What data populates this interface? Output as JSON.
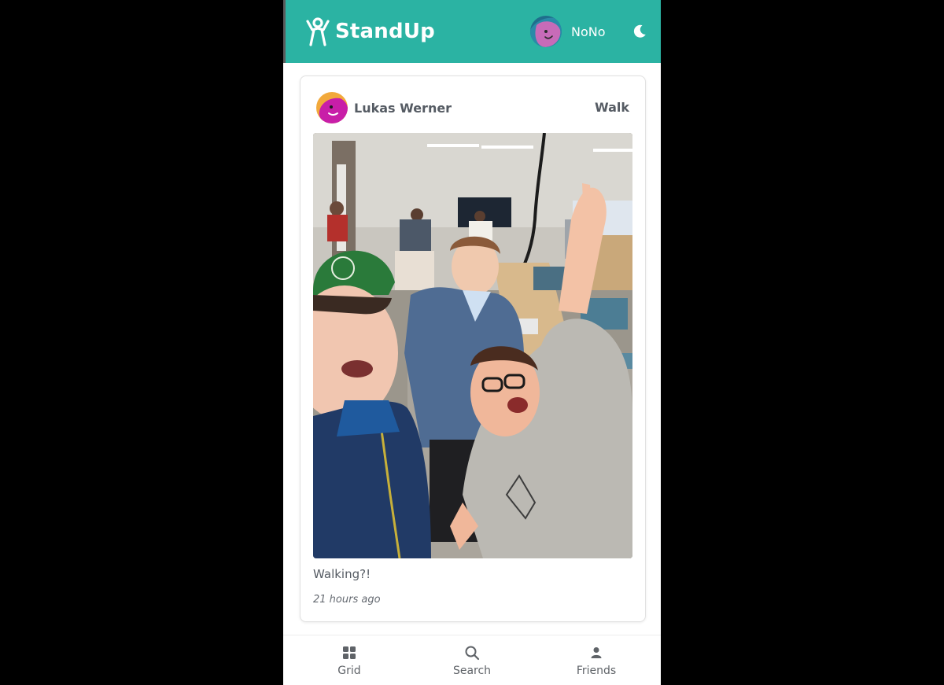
{
  "app": {
    "brand_name": "StandUp",
    "colors": {
      "header": "#2bb3a3",
      "text_muted": "#555b63"
    }
  },
  "header": {
    "user_name": "NoNo",
    "brand_icon": "person-waving-icon",
    "avatar_icon": "blob-face-avatar",
    "theme_toggle_icon": "moon-icon"
  },
  "post": {
    "author": "Lukas Werner",
    "activity": "Walk",
    "caption": "Walking?!",
    "time_ago": "21 hours ago",
    "photo_description_icon": "photo"
  },
  "bottom_nav": {
    "items": [
      {
        "label": "Grid",
        "icon": "grid-icon"
      },
      {
        "label": "Search",
        "icon": "search-icon"
      },
      {
        "label": "Friends",
        "icon": "person-icon"
      }
    ]
  }
}
